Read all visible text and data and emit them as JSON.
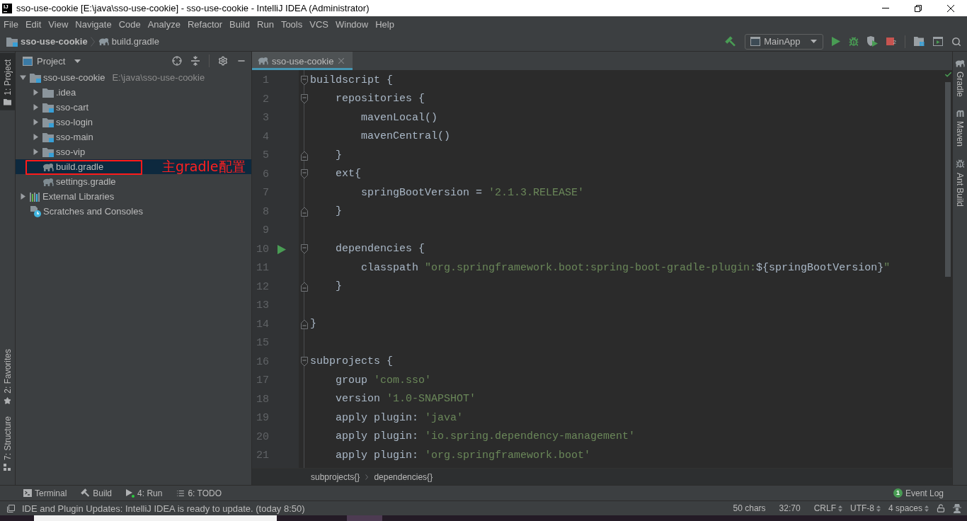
{
  "window": {
    "icon_text": "IJ",
    "title": "sso-use-cookie [E:\\java\\sso-use-cookie] - sso-use-cookie - IntelliJ IDEA (Administrator)"
  },
  "menu": [
    "File",
    "Edit",
    "View",
    "Navigate",
    "Code",
    "Analyze",
    "Refactor",
    "Build",
    "Run",
    "Tools",
    "VCS",
    "Window",
    "Help"
  ],
  "navbar": {
    "breadcrumbs": [
      {
        "kind": "module",
        "label": "sso-use-cookie"
      },
      {
        "kind": "gradle",
        "label": "build.gradle"
      }
    ],
    "run_config": "MainApp",
    "stop_badge": "2"
  },
  "left_stripe": {
    "top": [
      {
        "kind": "project",
        "label": "1: Project",
        "selected": true
      }
    ],
    "bottom": [
      {
        "kind": "favorites",
        "label": "2: Favorites",
        "selected": false
      },
      {
        "kind": "structure",
        "label": "7: Structure",
        "selected": false
      }
    ]
  },
  "project_panel": {
    "title": "Project",
    "tree": [
      {
        "kind": "module",
        "label": "sso-use-cookie",
        "path": "E:\\java\\sso-use-cookie",
        "expanded": true,
        "selected": false,
        "children": [
          {
            "kind": "folder",
            "label": ".idea",
            "expanded": false,
            "selected": false
          },
          {
            "kind": "module",
            "label": "sso-cart",
            "expanded": false,
            "selected": false
          },
          {
            "kind": "module",
            "label": "sso-login",
            "expanded": false,
            "selected": false
          },
          {
            "kind": "module",
            "label": "sso-main",
            "expanded": false,
            "selected": false
          },
          {
            "kind": "module",
            "label": "sso-vip",
            "expanded": false,
            "selected": false
          },
          {
            "kind": "gradle",
            "label": "build.gradle",
            "selected": true,
            "note": "主gradle配置"
          },
          {
            "kind": "gradle",
            "label": "settings.gradle",
            "selected": false
          }
        ]
      },
      {
        "kind": "library",
        "label": "External Libraries",
        "expanded": false,
        "selected": false
      },
      {
        "kind": "scratch",
        "label": "Scratches and Consoles",
        "selected": false
      }
    ]
  },
  "editor": {
    "tabs": [
      {
        "label": "sso-use-cookie",
        "selected": true
      }
    ],
    "lines": [
      {
        "number": "1",
        "kind": "open",
        "run": false,
        "tokens": [
          {
            "kind": "plain",
            "text": "buildscript {"
          }
        ]
      },
      {
        "number": "2",
        "kind": "open",
        "run": false,
        "tokens": [
          {
            "kind": "plain",
            "text": "    repositories {"
          }
        ]
      },
      {
        "number": "3",
        "kind": "plain",
        "run": false,
        "tokens": [
          {
            "kind": "plain",
            "text": "        mavenLocal()"
          }
        ]
      },
      {
        "number": "4",
        "kind": "plain",
        "run": false,
        "tokens": [
          {
            "kind": "plain",
            "text": "        mavenCentral()"
          }
        ]
      },
      {
        "number": "5",
        "kind": "close",
        "run": false,
        "tokens": [
          {
            "kind": "plain",
            "text": "    }"
          }
        ]
      },
      {
        "number": "6",
        "kind": "open",
        "run": false,
        "tokens": [
          {
            "kind": "plain",
            "text": "    ext{"
          }
        ]
      },
      {
        "number": "7",
        "kind": "plain",
        "run": false,
        "tokens": [
          {
            "kind": "plain",
            "text": "        springBootVersion = "
          },
          {
            "kind": "string",
            "text": "'2.1.3.RELEASE'"
          }
        ]
      },
      {
        "number": "8",
        "kind": "close",
        "run": false,
        "tokens": [
          {
            "kind": "plain",
            "text": "    }"
          }
        ]
      },
      {
        "number": "9",
        "kind": "plain",
        "run": false
      },
      {
        "number": "10",
        "kind": "open",
        "run": true,
        "tokens": [
          {
            "kind": "plain",
            "text": "    dependencies {"
          }
        ]
      },
      {
        "number": "11",
        "kind": "plain",
        "run": false,
        "tokens": [
          {
            "kind": "plain",
            "text": "        classpath "
          },
          {
            "kind": "string",
            "text": "\"org.springframework.boot:spring-boot-gradle-plugin:"
          },
          {
            "kind": "plain",
            "text": "${springBootVersion}"
          },
          {
            "kind": "string",
            "text": "\""
          }
        ]
      },
      {
        "number": "12",
        "kind": "close",
        "run": false,
        "tokens": [
          {
            "kind": "plain",
            "text": "    }"
          }
        ]
      },
      {
        "number": "13",
        "kind": "plain",
        "run": false
      },
      {
        "number": "14",
        "kind": "close",
        "run": false,
        "tokens": [
          {
            "kind": "plain",
            "text": "}"
          }
        ]
      },
      {
        "number": "15",
        "kind": "plain",
        "run": false
      },
      {
        "number": "16",
        "kind": "open",
        "run": false,
        "tokens": [
          {
            "kind": "plain",
            "text": "subprojects {"
          }
        ]
      },
      {
        "number": "17",
        "kind": "plain",
        "run": false,
        "tokens": [
          {
            "kind": "plain",
            "text": "    group "
          },
          {
            "kind": "string",
            "text": "'com.sso'"
          }
        ]
      },
      {
        "number": "18",
        "kind": "plain",
        "run": false,
        "tokens": [
          {
            "kind": "plain",
            "text": "    version "
          },
          {
            "kind": "string",
            "text": "'1.0-SNAPSHOT'"
          }
        ]
      },
      {
        "number": "19",
        "kind": "plain",
        "run": false,
        "tokens": [
          {
            "kind": "plain",
            "text": "    apply plugin: "
          },
          {
            "kind": "string",
            "text": "'java'"
          }
        ]
      },
      {
        "number": "20",
        "kind": "plain",
        "run": false,
        "tokens": [
          {
            "kind": "plain",
            "text": "    apply plugin: "
          },
          {
            "kind": "string",
            "text": "'io.spring.dependency-management'"
          }
        ]
      },
      {
        "number": "21",
        "kind": "plain",
        "run": false,
        "tokens": [
          {
            "kind": "plain",
            "text": "    apply plugin: "
          },
          {
            "kind": "string",
            "text": "'org.springframework.boot'"
          }
        ]
      }
    ],
    "breadcrumbs": [
      "subprojects{}",
      "dependencies{}"
    ]
  },
  "right_stripe": [
    {
      "kind": "gradle",
      "label": "Gradle"
    },
    {
      "kind": "maven",
      "label": "Maven"
    },
    {
      "kind": "ant",
      "label": "Ant Build"
    }
  ],
  "tool_windows": {
    "items": [
      {
        "kind": "terminal",
        "label": "Terminal"
      },
      {
        "kind": "build",
        "label": "Build"
      },
      {
        "kind": "run",
        "label": "4: Run"
      },
      {
        "kind": "todo",
        "label": "6: TODO"
      }
    ],
    "event_log": {
      "label": "Event Log",
      "badge": "1"
    }
  },
  "status_bar": {
    "message": "IDE and Plugin Updates: IntelliJ IDEA is ready to update. (today 8:50)",
    "items": [
      {
        "kind": "plain",
        "text": "50 chars"
      },
      {
        "kind": "plain",
        "text": "32:70"
      },
      {
        "kind": "select",
        "text": "CRLF"
      },
      {
        "kind": "select",
        "text": "UTF-8"
      },
      {
        "kind": "select",
        "text": "4 spaces"
      }
    ]
  }
}
